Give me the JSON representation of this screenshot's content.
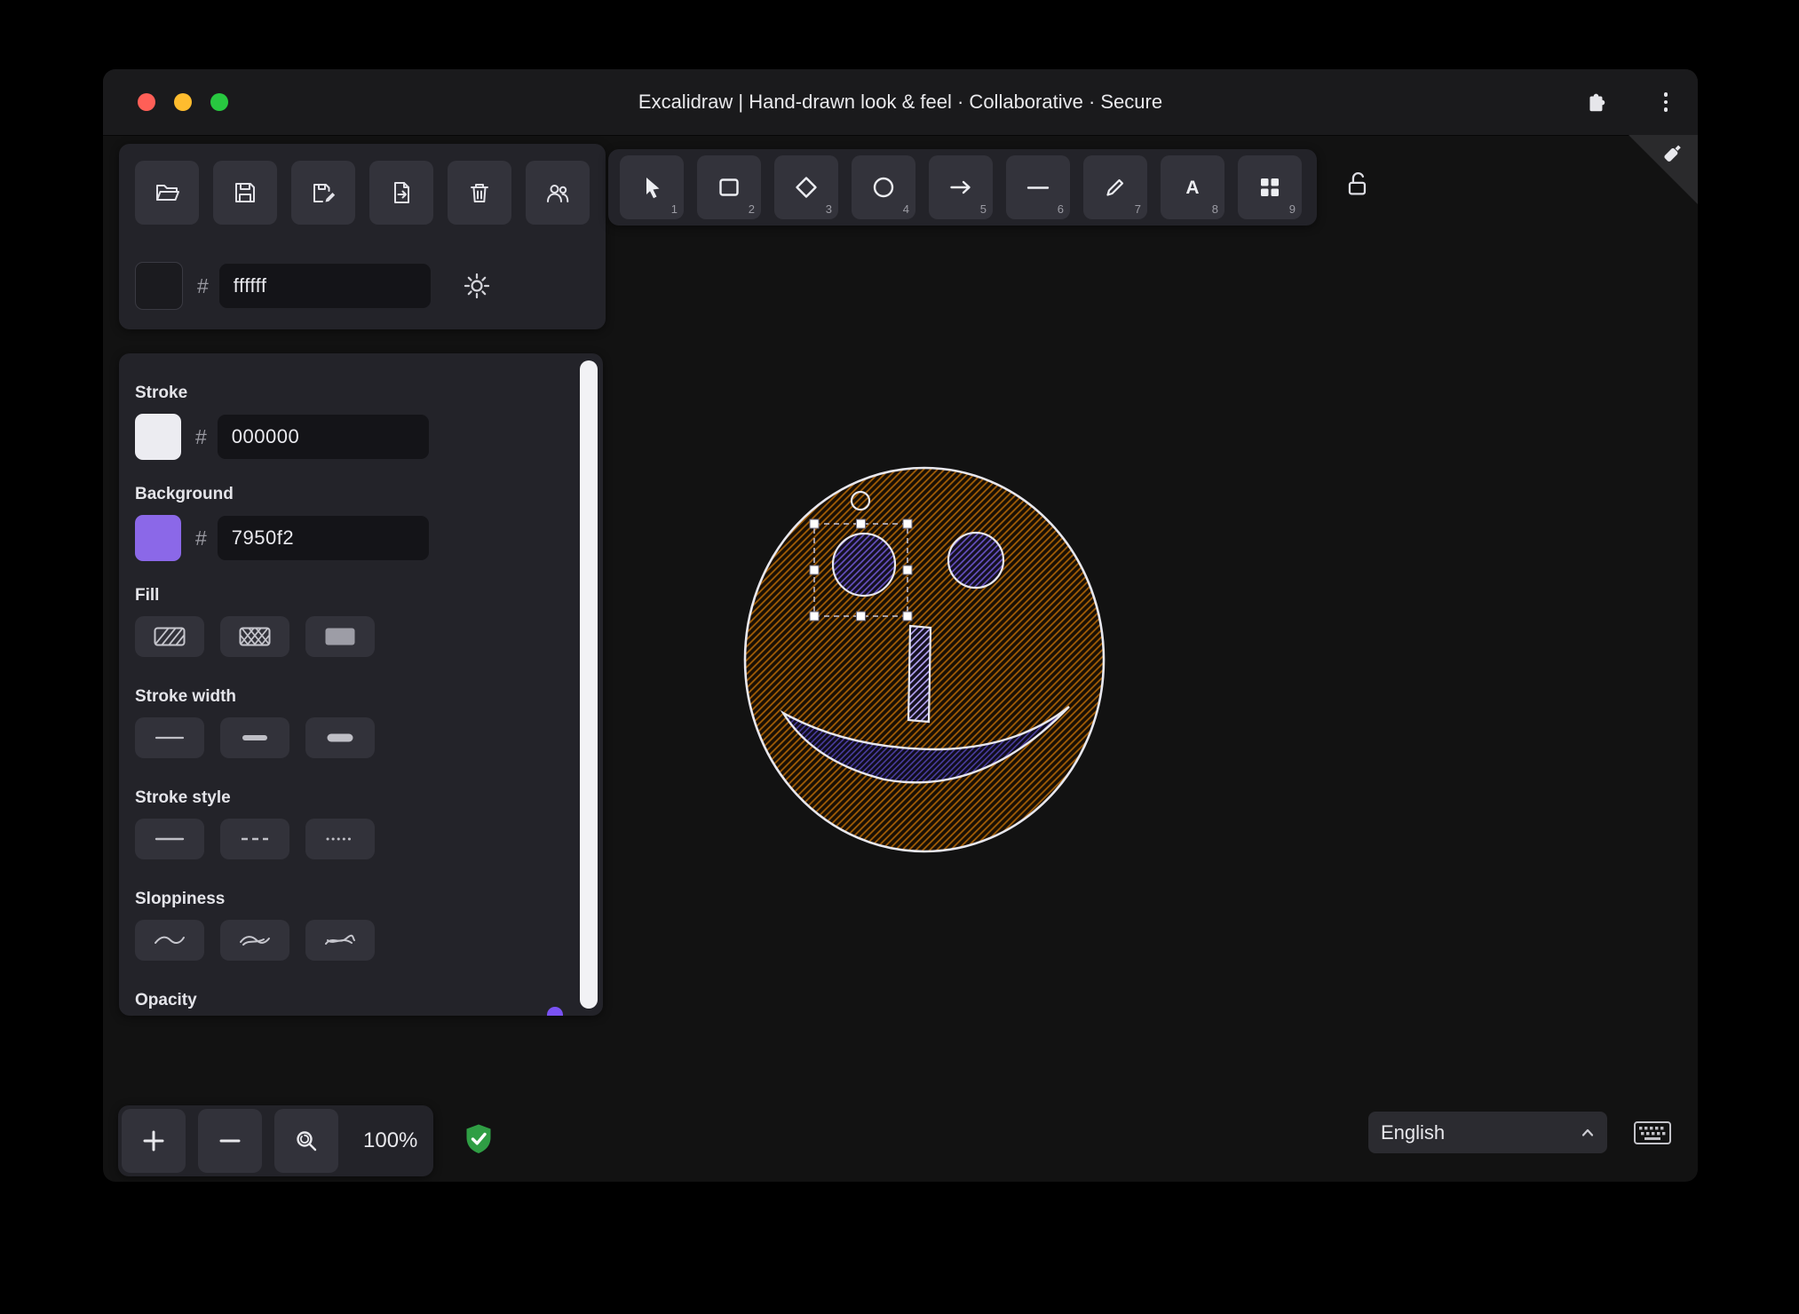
{
  "window": {
    "title": "Excalidraw | Hand-drawn look & feel · Collaborative · Secure"
  },
  "titlebar": {
    "icons": [
      "extension-puzzle-icon",
      "kebab-menu-icon"
    ],
    "controls": [
      "close",
      "minimize",
      "zoom"
    ]
  },
  "actions": {
    "buttons": [
      "open",
      "save",
      "save-as",
      "export",
      "clear-canvas",
      "collaboration"
    ]
  },
  "canvas_background": {
    "hash": "#",
    "value": "ffffff",
    "icon": "sun-icon"
  },
  "toolbar": {
    "tools": [
      {
        "name": "selection",
        "shortcut": "1"
      },
      {
        "name": "rectangle",
        "shortcut": "2"
      },
      {
        "name": "diamond",
        "shortcut": "3"
      },
      {
        "name": "ellipse",
        "shortcut": "4"
      },
      {
        "name": "arrow",
        "shortcut": "5"
      },
      {
        "name": "line",
        "shortcut": "6"
      },
      {
        "name": "draw",
        "shortcut": "7"
      },
      {
        "name": "text",
        "shortcut": "8"
      },
      {
        "name": "shapes",
        "shortcut": "9"
      }
    ],
    "lock_icon": "unlocked-padlock"
  },
  "panel": {
    "stroke": {
      "label": "Stroke",
      "hash": "#",
      "value": "000000",
      "swatch": "#ececf1"
    },
    "background": {
      "label": "Background",
      "hash": "#",
      "value": "7950f2",
      "swatch": "#8b68e8"
    },
    "fill": {
      "label": "Fill",
      "options": [
        "hachure",
        "cross-hatch",
        "solid"
      ]
    },
    "stroke_width": {
      "label": "Stroke width",
      "options": [
        "thin",
        "bold",
        "extra-bold"
      ]
    },
    "stroke_style": {
      "label": "Stroke style",
      "options": [
        "solid",
        "dashed",
        "dotted"
      ]
    },
    "sloppiness": {
      "label": "Sloppiness",
      "options": [
        "architect",
        "artist",
        "cartoonist"
      ]
    },
    "opacity": {
      "label": "Opacity"
    }
  },
  "footer": {
    "zoom_level": "100%",
    "encryption_icon": "green-shield-check",
    "language": "English",
    "keyboard_icon": "keyboard"
  },
  "colors": {
    "canvas": "#121212",
    "island": "#232329",
    "accent": "#7a52f4",
    "stroke_swatch": "#ececf1",
    "background_swatch": "#8b68e8",
    "shield_green": "#2f9e44",
    "face_hatch": "#a35e06",
    "eye_hatch": "#6a54c8"
  }
}
